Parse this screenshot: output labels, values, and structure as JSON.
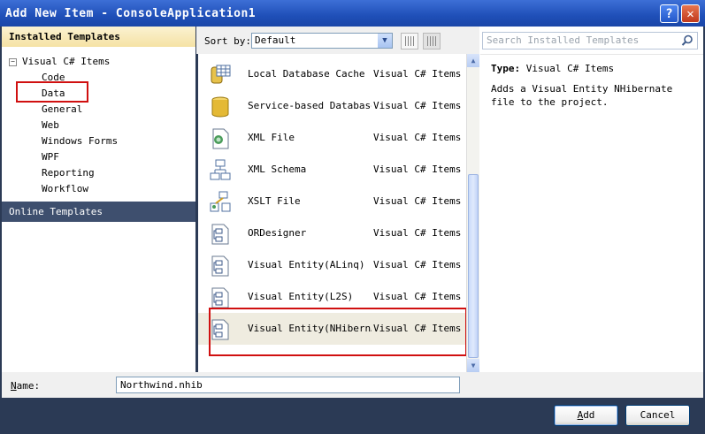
{
  "window": {
    "title": "Add New Item - ConsoleApplication1",
    "help_glyph": "?",
    "close_glyph": "✕"
  },
  "left": {
    "installed_header": "Installed Templates",
    "root": {
      "expander": "−",
      "label": "Visual C# Items"
    },
    "items": [
      "Code",
      "Data",
      "General",
      "Web",
      "Windows Forms",
      "WPF",
      "Reporting",
      "Workflow"
    ],
    "online_header": "Online Templates"
  },
  "toolbar": {
    "sort_label": "Sort by:",
    "sort_value": "Default",
    "arrow_glyph": "▼"
  },
  "templates": [
    {
      "name": "Local Database Cache",
      "category": "Visual C# Items",
      "icon": "database-cache-icon"
    },
    {
      "name": "Service-based Database",
      "category": "Visual C# Items",
      "icon": "database-icon"
    },
    {
      "name": "XML File",
      "category": "Visual C# Items",
      "icon": "xml-file-icon"
    },
    {
      "name": "XML Schema",
      "category": "Visual C# Items",
      "icon": "xml-schema-icon"
    },
    {
      "name": "XSLT File",
      "category": "Visual C# Items",
      "icon": "xslt-file-icon"
    },
    {
      "name": "ORDesigner",
      "category": "Visual C# Items",
      "icon": "designer-icon"
    },
    {
      "name": "Visual Entity(ALinq)",
      "category": "Visual C# Items",
      "icon": "designer-icon"
    },
    {
      "name": "Visual Entity(L2S)",
      "category": "Visual C# Items",
      "icon": "designer-icon"
    },
    {
      "name": "Visual Entity(NHibern…",
      "category": "Visual C# Items",
      "icon": "designer-icon",
      "selected": true
    }
  ],
  "scroll": {
    "up_glyph": "▲",
    "down_glyph": "▼"
  },
  "search": {
    "placeholder": "Search Installed Templates"
  },
  "details": {
    "type_label": "Type:",
    "type_value": "Visual C# Items",
    "description": "Adds a Visual Entity NHibernate file to the project."
  },
  "name_field": {
    "label_accel": "N",
    "label_rest": "ame:",
    "value": "Northwind.nhib"
  },
  "buttons": {
    "add_accel": "A",
    "add_rest": "dd",
    "cancel": "Cancel"
  }
}
